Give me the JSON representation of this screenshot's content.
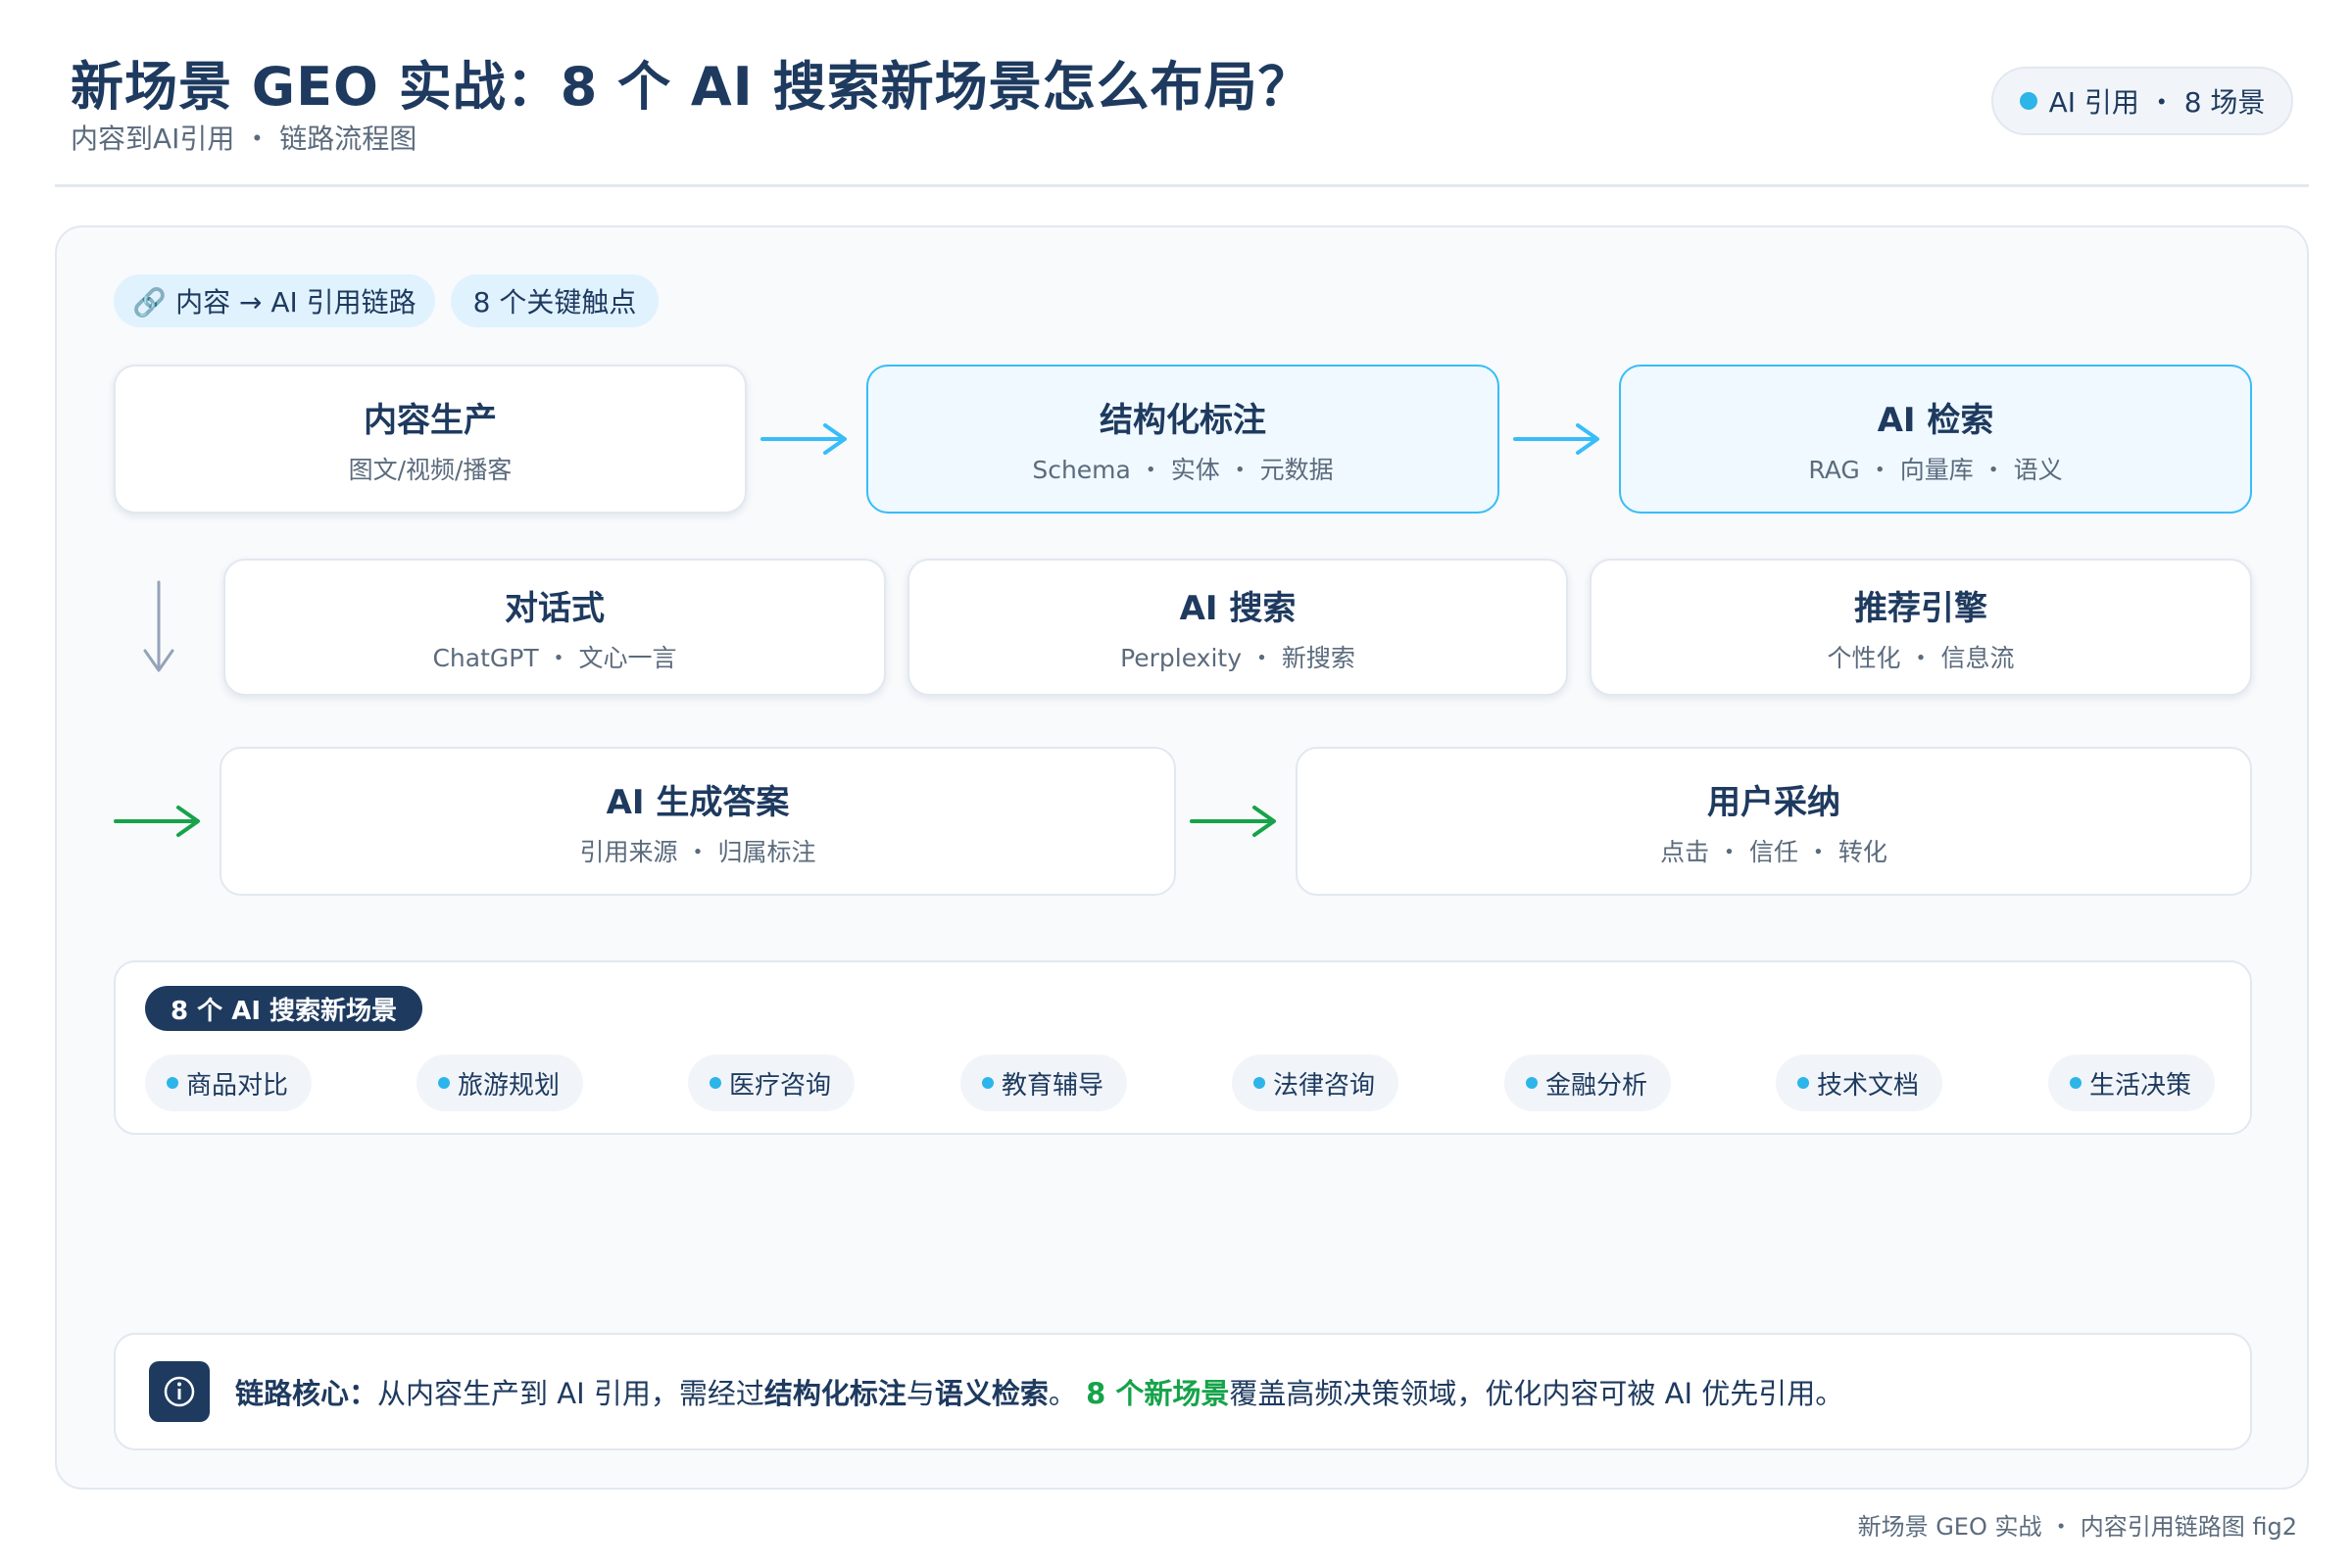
{
  "header": {
    "title": "新场景 GEO 实战：8 个 AI 搜索新场景怎么布局？",
    "subtitle": "内容到AI引用 ・ 链路流程图",
    "badge": "AI 引用 ・ 8 场景"
  },
  "chips": {
    "link_chain": "🔗 内容 → AI 引用链路",
    "touchpoints": "8 个关键触点"
  },
  "flow": {
    "content_production": {
      "title": "内容生产",
      "sub": "图文/视频/播客"
    },
    "structured_markup": {
      "title": "结构化标注",
      "sub": "Schema ・ 实体 ・ 元数据"
    },
    "ai_retrieval": {
      "title": "AI 检索",
      "sub": "RAG ・ 向量库 ・ 语义"
    },
    "conversational": {
      "title": "对话式",
      "sub": "ChatGPT ・ 文心一言"
    },
    "ai_search": {
      "title": "AI 搜索",
      "sub": "Perplexity ・ 新搜索"
    },
    "recommendation_engine": {
      "title": "推荐引擎",
      "sub": "个性化 ・ 信息流"
    },
    "ai_answer": {
      "title": "AI 生成答案",
      "sub": "引用来源 ・ 归属标注"
    },
    "user_adoption": {
      "title": "用户采纳",
      "sub": "点击 ・ 信任 ・ 转化"
    }
  },
  "scenarios": {
    "title": "8 个 AI 搜索新场景",
    "items": [
      "商品对比",
      "旅游规划",
      "医疗咨询",
      "教育辅导",
      "法律咨询",
      "金融分析",
      "技术文档",
      "生活决策"
    ]
  },
  "core": {
    "lead": "链路核心：",
    "part1": "从内容生产到 AI 引用，需经过",
    "bold1": "结构化标注",
    "part2": "与",
    "bold2": "语义检索",
    "part3": "。 ",
    "highlight": "8 个新场景",
    "part4": "覆盖高频决策领域，优化内容可被 AI 优先引用。"
  },
  "footer": "新场景 GEO 实战 ・ 内容引用链路图 fig2",
  "colors": {
    "navy": "#1e3a5f",
    "sky": "#38bdf8",
    "green": "#16a34a",
    "amber": "#f59e0b",
    "gray_arrow": "#94a3b8"
  }
}
